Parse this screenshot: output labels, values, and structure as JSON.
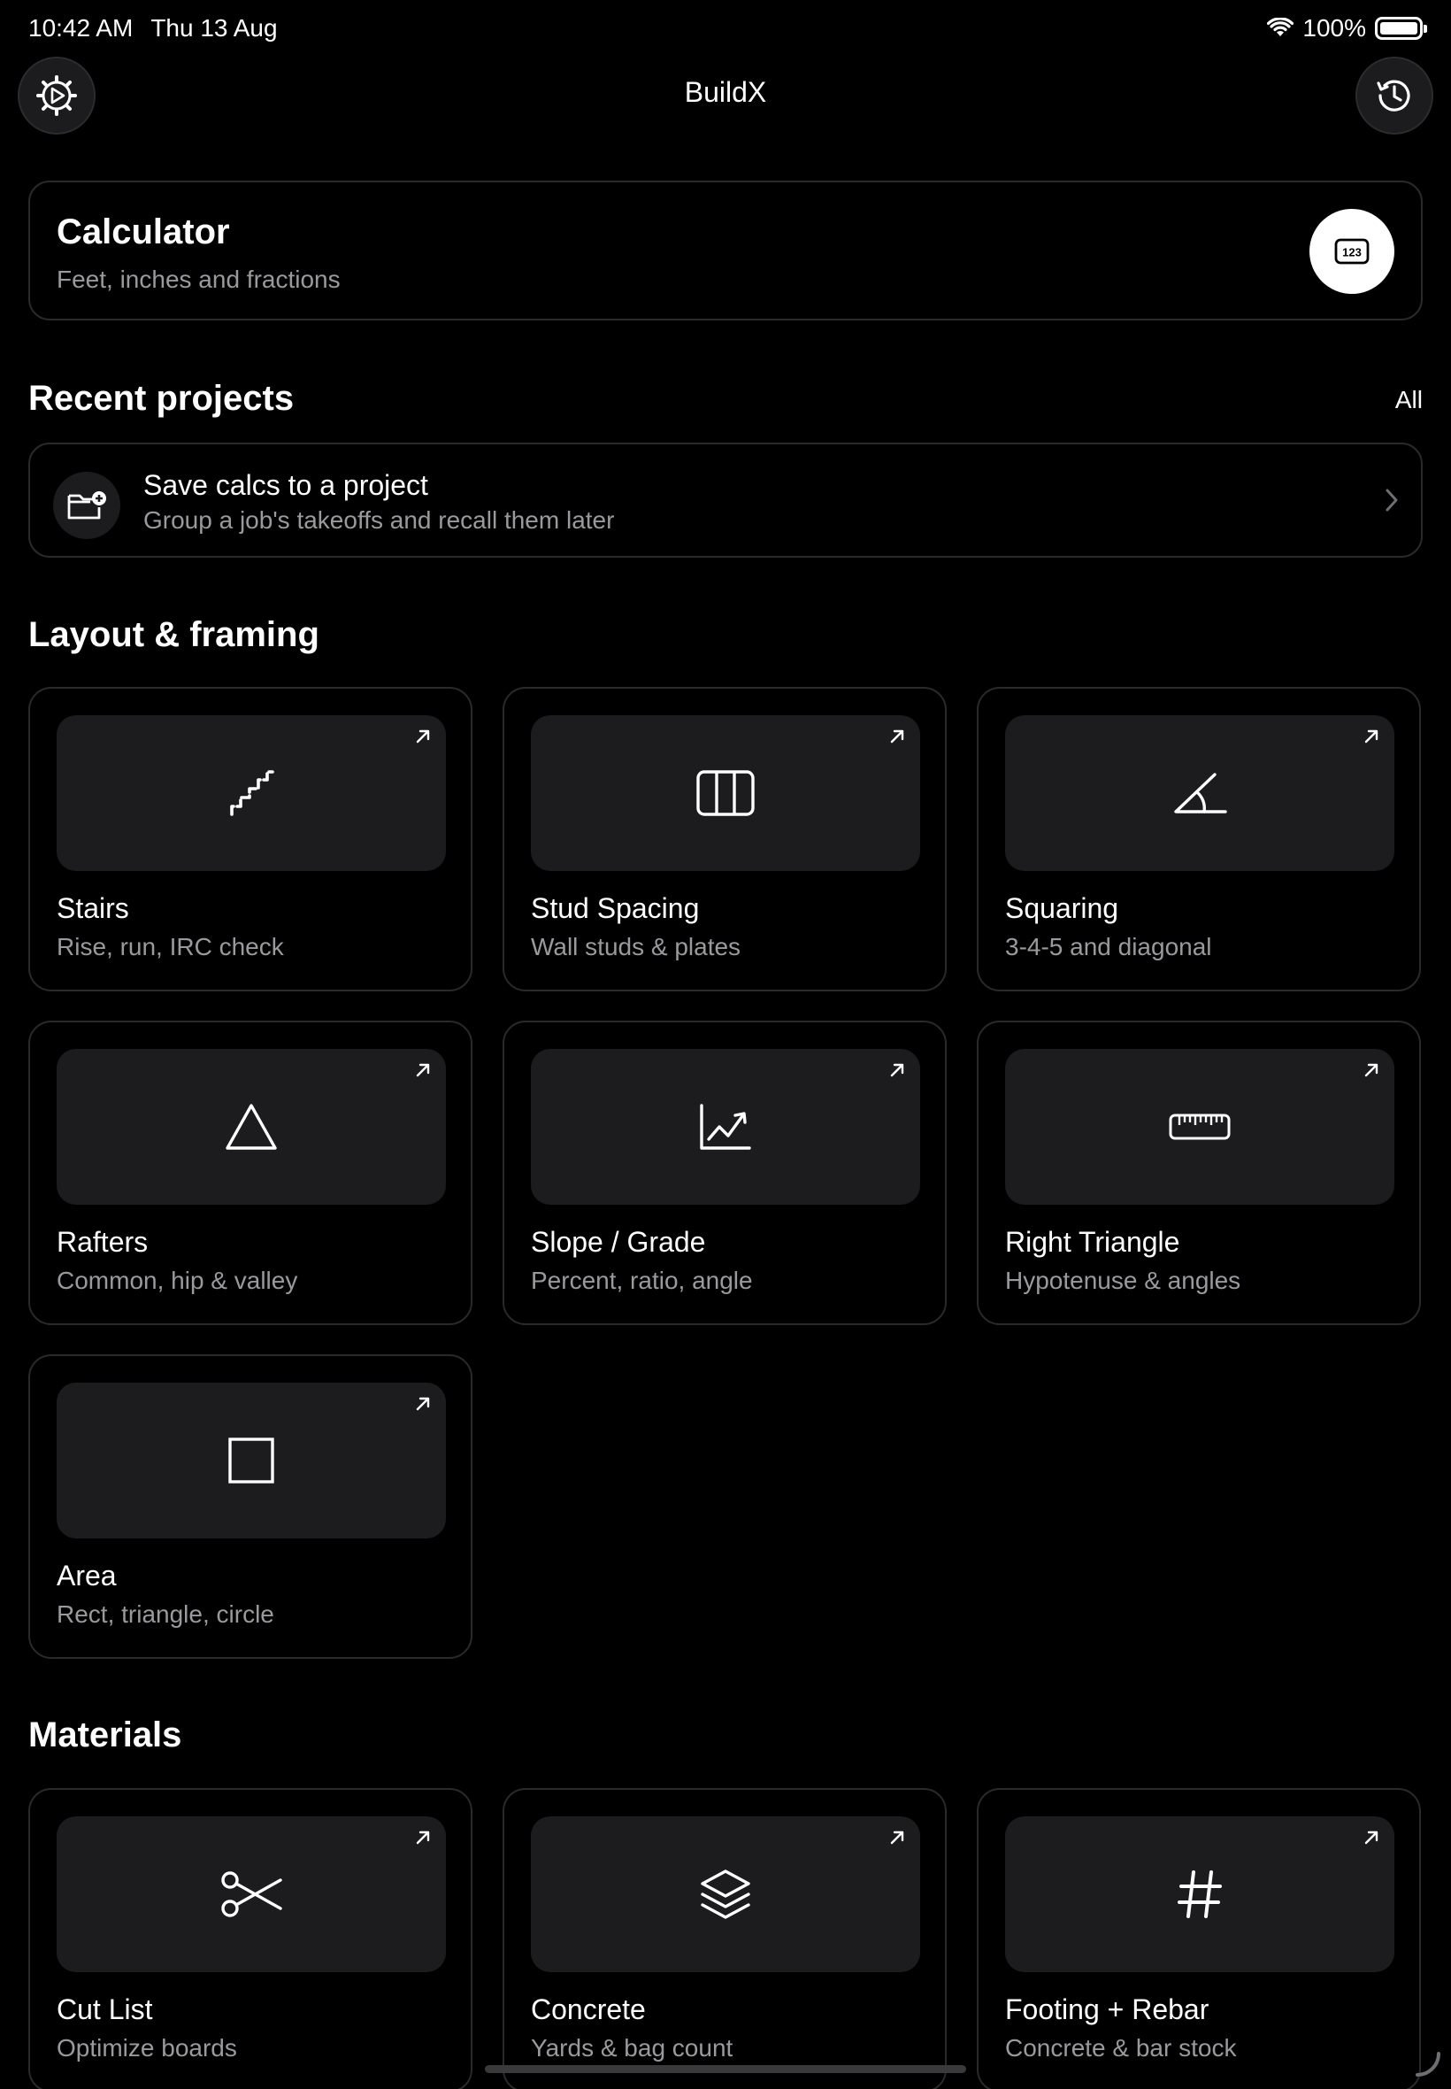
{
  "status_bar": {
    "time": "10:42 AM",
    "date": "Thu 13 Aug",
    "battery_text": "100%",
    "battery_level": 1.0
  },
  "nav": {
    "title": "BuildX",
    "left_icon": "settings-gear-icon",
    "right_icon": "history-clock-icon"
  },
  "calculator": {
    "title": "Calculator",
    "subtitle": "Feet, inches and fractions",
    "icon": "numeric-keypad-icon"
  },
  "recent_projects": {
    "title": "Recent projects",
    "all_label": "All",
    "empty_row": {
      "title": "Save calcs to a project",
      "subtitle": "Group a job's takeoffs and recall them later",
      "icon": "folder-add-icon"
    }
  },
  "layout_framing": {
    "title": "Layout & framing",
    "tools": [
      {
        "name": "Stairs",
        "desc": "Rise, run, IRC check",
        "icon": "stairs-icon"
      },
      {
        "name": "Stud Spacing",
        "desc": "Wall studs & plates",
        "icon": "columns-icon"
      },
      {
        "name": "Squaring",
        "desc": "3-4-5 and diagonal",
        "icon": "angle-icon"
      },
      {
        "name": "Rafters",
        "desc": "Common, hip & valley",
        "icon": "triangle-icon"
      },
      {
        "name": "Slope / Grade",
        "desc": "Percent, ratio, angle",
        "icon": "trend-chart-icon"
      },
      {
        "name": "Right Triangle",
        "desc": "Hypotenuse & angles",
        "icon": "ruler-icon"
      },
      {
        "name": "Area",
        "desc": "Rect, triangle, circle",
        "icon": "square-icon"
      }
    ]
  },
  "materials": {
    "title": "Materials",
    "tools": [
      {
        "name": "Cut List",
        "desc": "Optimize boards",
        "icon": "scissors-icon"
      },
      {
        "name": "Concrete",
        "desc": "Yards & bag count",
        "icon": "layers-icon"
      },
      {
        "name": "Footing + Rebar",
        "desc": "Concrete & bar stock",
        "icon": "hash-icon"
      }
    ]
  }
}
